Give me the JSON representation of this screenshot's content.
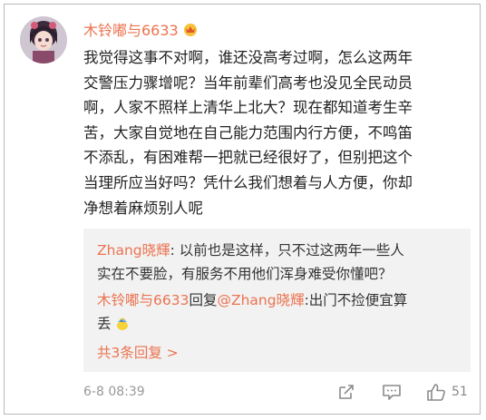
{
  "user": {
    "name": "木铃嘟与6633"
  },
  "comment": {
    "lines": [
      "我觉得这事不对啊，谁还没高考过啊，怎么这两年",
      "交警压力骤增呢？当年前辈们高考也没见全民动员",
      "啊，人家不照样上清华上北大？现在都知道考生辛",
      "苦，大家自觉地在自己能力范围内行方便，不鸣笛",
      "不添乱，有困难帮一把就已经很好了，但别把这个",
      "当理所应当好吗？凭什么我们想着与人方便，你却",
      "净想着麻烦别人呢"
    ]
  },
  "replies": {
    "r1_user": "Zhang晓輝",
    "r1_line1": ": 以前也是这样，只不过这两年一些人",
    "r1_line2": "实在不要脸，有服务不用他们浑身难受你懂吧？",
    "r2_user": "木铃嘟与6633",
    "r2_mid": "回复",
    "r2_at": "@Zhang晓輝",
    "r2_line1": ":出门不捡便宜算",
    "r2_line2": "丢",
    "more": "共3条回复 >"
  },
  "footer": {
    "time": "6-8 08:39",
    "likes": "51"
  },
  "colors": {
    "accent": "#eb7350",
    "reply_bg": "#f2f2f2",
    "muted": "#999999"
  },
  "icons": [
    "avatar-image",
    "vip-crown-icon",
    "emoji-chick-icon",
    "share-icon",
    "comment-icon",
    "like-icon"
  ]
}
